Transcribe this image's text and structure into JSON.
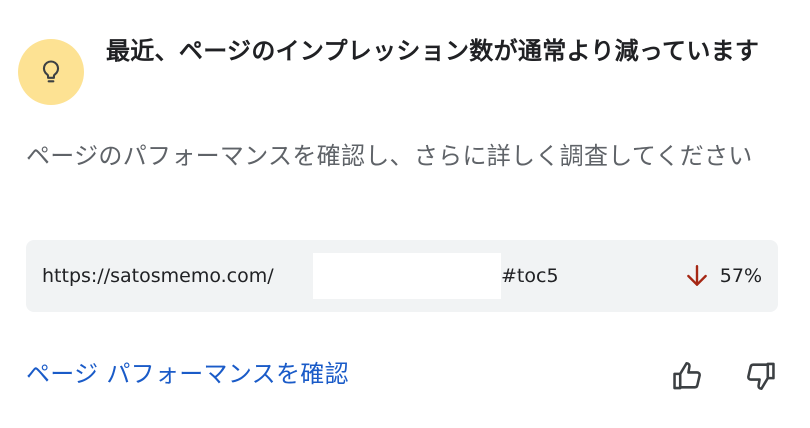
{
  "insight": {
    "icon": "lightbulb-icon",
    "icon_bg_color": "#fde293",
    "title": "最近、ページのインプレッション数が通常より減っています",
    "description": "ページのパフォーマンスを確認し、さらに詳しく調査してください"
  },
  "url_row": {
    "url_prefix": "https://satosmemo.com/",
    "url_suffix": "#toc5",
    "trend_icon": "arrow-down-icon",
    "trend_color": "#a52714",
    "change": "57%"
  },
  "actions": {
    "link_label": "ページ パフォーマンスを確認",
    "link_color": "#1a5bc8",
    "thumbs_up_icon": "thumbs-up-icon",
    "thumbs_down_icon": "thumbs-down-icon"
  }
}
